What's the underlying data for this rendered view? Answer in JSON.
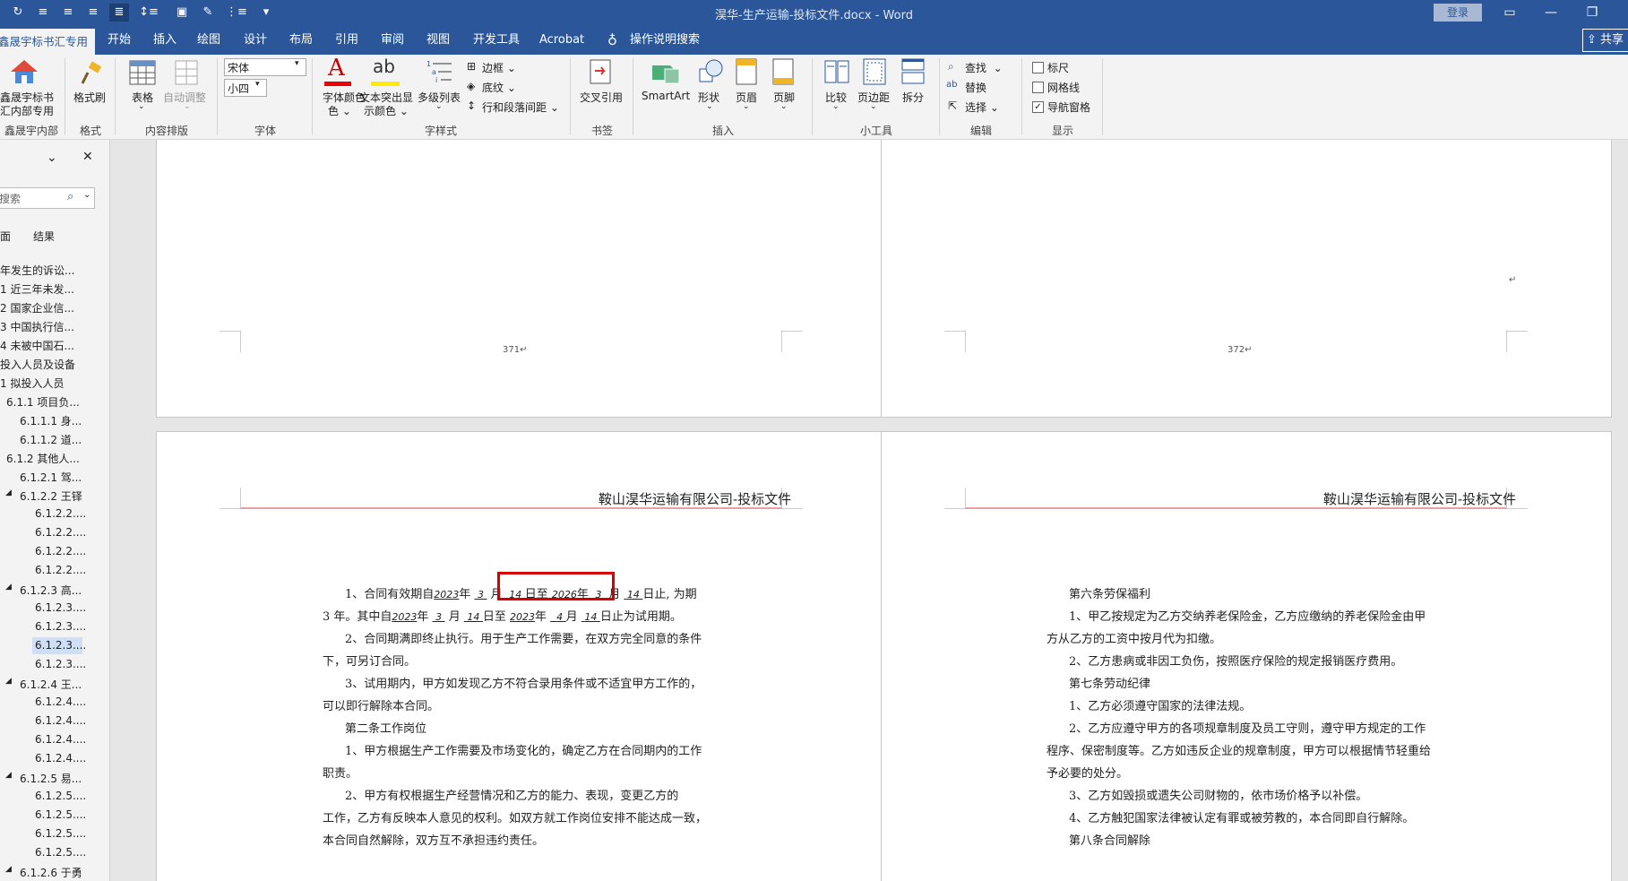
{
  "window": {
    "title": "淏华-生产运输-投标文件.docx - Word",
    "login": "登录",
    "minimize_icon": "minimize-icon",
    "restore_icon": "restore-icon"
  },
  "tabs": {
    "active": "鑫晟宇标书汇专用",
    "items": [
      "开始",
      "插入",
      "绘图",
      "设计",
      "布局",
      "引用",
      "审阅",
      "视图",
      "开发工具",
      "Acrobat"
    ],
    "tell_me": "操作说明搜索",
    "share": "共享"
  },
  "ribbon": {
    "biaoshu": {
      "line1": "鑫晟宇标书",
      "line2": "汇内部专用",
      "group": "鑫晟宇内部专用"
    },
    "format_painter": {
      "label": "格式刷",
      "group": "格式"
    },
    "table": {
      "label": "表格",
      "auto_adjust": "自动调整",
      "group": "内容排版"
    },
    "font": {
      "name": "宋体",
      "size": "小四",
      "group": "字体"
    },
    "style": {
      "font_color": "字体颜色",
      "font_color_suffix": "色",
      "highlight": "文本突出显",
      "highlight_suffix": "示颜色",
      "multilevel": "多级列表",
      "border": "边框",
      "shading": "底纹",
      "spacing": "行和段落间距",
      "group": "字样式"
    },
    "crossref": {
      "label": "交叉引用",
      "group": "书签"
    },
    "insert": {
      "smartart": "SmartArt",
      "shape": "形状",
      "header": "页眉",
      "footer": "页脚",
      "group": "插入"
    },
    "tools": {
      "compare": "比较",
      "margins": "页边距",
      "split": "拆分",
      "group": "小工具"
    },
    "edit": {
      "find": "查找",
      "replace": "替换",
      "select": "选择",
      "group": "编辑"
    },
    "show": {
      "ruler": "标尺",
      "gridlines": "网格线",
      "nav_pane": "导航窗格",
      "group": "显示",
      "ruler_checked": false,
      "gridlines_checked": false,
      "nav_checked": true
    }
  },
  "nav": {
    "search_placeholder": "搜索",
    "tab_pages": "页面",
    "tab_results": "结果",
    "items": [
      "近年发生的诉讼...",
      "1 近三年未发...",
      "2 国家企业信...",
      "3 中国执行信...",
      "4 未被中国石...",
      "拟投入人员及设备",
      "1 拟投入人员",
      "6.1.1 项目负...",
      "6.1.1.1 身...",
      "6.1.1.2 道...",
      "6.1.2 其他人...",
      "6.1.2.1 驾...",
      "6.1.2.2 王铎",
      "6.1.2.2....",
      "6.1.2.2....",
      "6.1.2.2....",
      "6.1.2.2....",
      "6.1.2.3 高...",
      "6.1.2.3....",
      "6.1.2.3....",
      "6.1.2.3....",
      "6.1.2.3....",
      "6.1.2.4 王...",
      "6.1.2.4....",
      "6.1.2.4....",
      "6.1.2.4....",
      "6.1.2.4....",
      "6.1.2.5 易...",
      "6.1.2.5....",
      "6.1.2.5....",
      "6.1.2.5....",
      "6.1.2.5....",
      "6.1.2.6 于勇"
    ]
  },
  "pages": {
    "p371_num": "371↵",
    "p372_num": "372↵",
    "p372_mark": "↵",
    "header_title": "鞍山淏华运输有限公司-投标文件",
    "left": {
      "l1a": "1、合同有效期自",
      "y1": "2023",
      "nian": "年",
      "m1": "3",
      "yue": "月",
      "d1": "14",
      "ri_zhi": "日至",
      "y2": "2026",
      "m2": "3",
      "d2": "14",
      "ri_zhi2": "日止,",
      "wei_qi": "为期",
      "l2a": "3 年。其中自",
      "y3": "2023",
      "m3": "3",
      "d3": "14",
      "ri_zhi3": "日至",
      "y4": "2023",
      "m4": "4",
      "d4": "14",
      "l2b": "日止为试用期。",
      "l3": "2、合同期满即终止执行。用于生产工作需要，在双方完全同意的条件",
      "l4": "下，可另订合同。",
      "l5": "3、试用期内，甲方如发现乙方不符合录用条件或不适宜甲方工作的，",
      "l6": "可以即行解除本合同。",
      "l7": "第二条工作岗位",
      "l8": "1、甲方根据生产工作需要及市场变化的，确定乙方在合同期内的工作",
      "l9": "职责。",
      "l10": "2、甲方有权根据生产经营情况和乙方的能力、表现，变更乙方的",
      "l11": "工作，乙方有反映本人意见的权利。如双方就工作岗位安排不能达成一致，",
      "l12": "本合同自然解除，双方互不承担违约责任。"
    },
    "right": {
      "r1": "第六条劳保福利",
      "r2": "1、甲乙按规定为乙方交纳养老保险金，乙方应缴纳的养老保险金由甲",
      "r3": "方从乙方的工资中按月代为扣缴。",
      "r4": "2、乙方患病或非因工负伤，按照医疗保险的规定报销医疗费用。",
      "r5": "第七条劳动纪律",
      "r6": "1、乙方必须遵守国家的法律法规。",
      "r7": "2、乙方应遵守甲方的各项规章制度及员工守则，遵守甲方规定的工作",
      "r8": "程序、保密制度等。乙方如违反企业的规章制度，甲方可以根据情节轻重给",
      "r9": "予必要的处分。",
      "r10": "3、乙方如毁损或遗失公司财物的，依市场价格予以补偿。",
      "r11": "4、乙方触犯国家法律被认定有罪或被劳教的，本合同即自行解除。",
      "r12": "第八条合同解除"
    }
  },
  "colors": {
    "title_bar": "#2b579a",
    "highlight_box": "#d40000",
    "header_rule": "#e8a0a0"
  }
}
